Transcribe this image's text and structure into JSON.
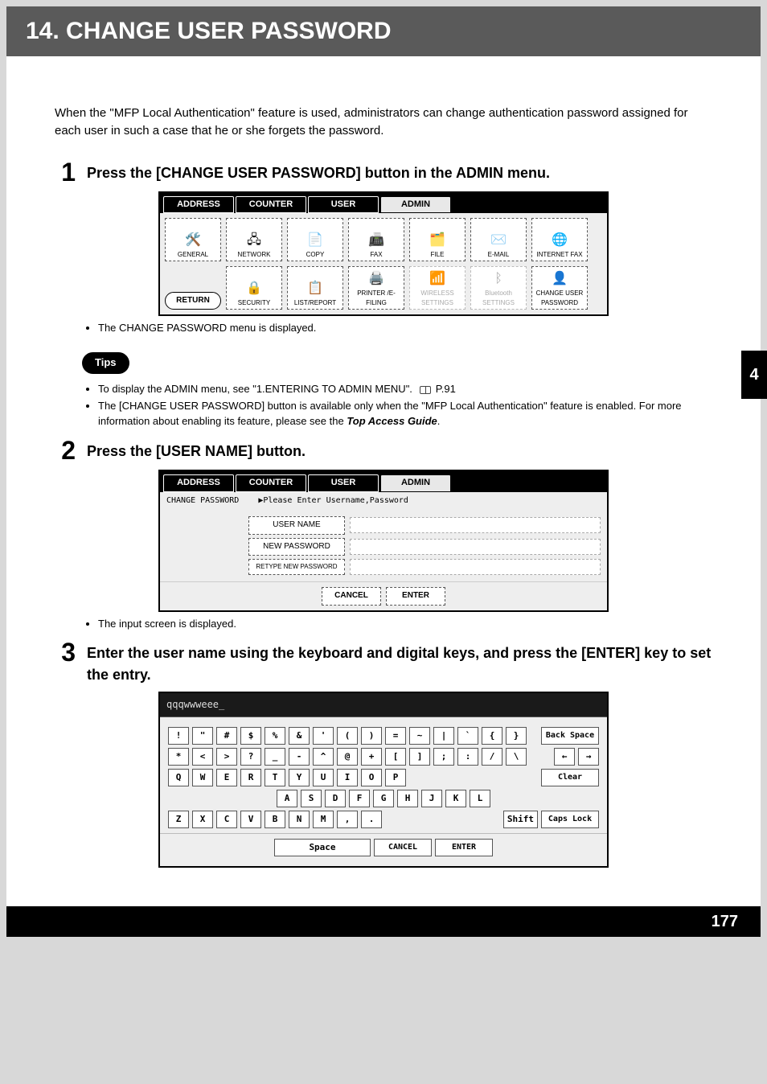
{
  "header": {
    "title": "14. CHANGE USER PASSWORD"
  },
  "section_index": "4",
  "page_number": "177",
  "intro": "When the \"MFP Local Authentication\" feature is used, administrators can change authentication password assigned for each user in such a case that he or she forgets the password.",
  "steps": {
    "s1": {
      "num": "1",
      "title": "Press the [CHANGE USER PASSWORD] button in the ADMIN menu."
    },
    "s2": {
      "num": "2",
      "title": "Press the [USER NAME] button."
    },
    "s3": {
      "num": "3",
      "title": "Enter the user name using the keyboard and digital keys, and press the [ENTER] key to set the entry."
    }
  },
  "notes": {
    "after1": "The CHANGE PASSWORD menu is displayed.",
    "tips_label": "Tips",
    "tip1_a": "To display the ADMIN menu, see \"1.ENTERING TO ADMIN MENU\".",
    "tip1_b": "P.91",
    "tip2_a": "The [CHANGE USER PASSWORD] button is available only when the \"MFP Local Authentication\" feature is enabled. For more information about enabling its feature, please see the ",
    "tip2_b": "Top Access Guide",
    "tip2_c": ".",
    "after2": "The input screen is displayed."
  },
  "panel1": {
    "tabs": [
      "ADDRESS",
      "COUNTER",
      "USER",
      "ADMIN"
    ],
    "row1": [
      "GENERAL",
      "NETWORK",
      "COPY",
      "FAX",
      "FILE",
      "E-MAIL",
      "INTERNET FAX"
    ],
    "row2": [
      "SECURITY",
      "LIST/REPORT",
      "PRINTER /E-FILING",
      "WIRELESS SETTINGS",
      "Bluetooth SETTINGS",
      "CHANGE USER PASSWORD"
    ],
    "return": "RETURN",
    "glyphs": {
      "GENERAL": "🛠️",
      "NETWORK": "🖧",
      "COPY": "📄",
      "FAX": "📠",
      "FILE": "🗂️",
      "E-MAIL": "✉️",
      "INTERNET FAX": "🌐",
      "SECURITY": "🔒",
      "LIST/REPORT": "📋",
      "PRINTER /E-FILING": "🖨️",
      "WIRELESS SETTINGS": "📶",
      "Bluetooth SETTINGS": "ᛒ",
      "CHANGE USER PASSWORD": "👤"
    },
    "disabled": [
      "WIRELESS SETTINGS",
      "Bluetooth SETTINGS"
    ]
  },
  "panel2": {
    "tabs": [
      "ADDRESS",
      "COUNTER",
      "USER",
      "ADMIN"
    ],
    "crumb_left": "CHANGE PASSWORD",
    "crumb_right": "▶Please Enter Username,Password",
    "fields": [
      "USER NAME",
      "NEW PASSWORD",
      "RETYPE NEW PASSWORD"
    ],
    "actions": [
      "CANCEL",
      "ENTER"
    ]
  },
  "panel3": {
    "entered": "qqqwwweee_",
    "row_sym1": [
      "!",
      "\"",
      "#",
      "$",
      "%",
      "&",
      "'",
      "(",
      ")",
      "=",
      "~",
      "|",
      "`",
      "{",
      "}"
    ],
    "row_sym2": [
      "*",
      "<",
      ">",
      "?",
      "_",
      "-",
      "^",
      "@",
      "+",
      "[",
      "]",
      ";",
      ":",
      "/",
      "\\"
    ],
    "row_q": [
      "Q",
      "W",
      "E",
      "R",
      "T",
      "Y",
      "U",
      "I",
      "O",
      "P"
    ],
    "row_a": [
      "A",
      "S",
      "D",
      "F",
      "G",
      "H",
      "J",
      "K",
      "L"
    ],
    "row_z": [
      "Z",
      "X",
      "C",
      "V",
      "B",
      "N",
      "M",
      ",",
      "."
    ],
    "right": {
      "backspace": "Back Space",
      "left": "←",
      "right": "→",
      "clear": "Clear",
      "shift": "Shift",
      "caps": "Caps Lock"
    },
    "bottom": {
      "space": "Space",
      "cancel": "CANCEL",
      "enter": "ENTER"
    }
  }
}
